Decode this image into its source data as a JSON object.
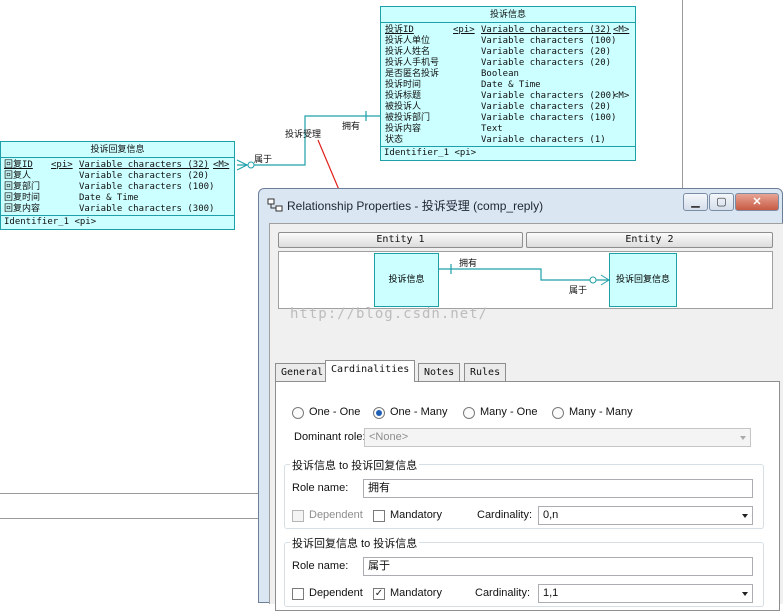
{
  "diagram": {
    "entity_main": {
      "title": "投诉信息",
      "rows": [
        {
          "name": "投诉ID",
          "key": "<pi>",
          "type": "Variable characters (32)",
          "flag": "<M>"
        },
        {
          "name": "投诉人单位",
          "key": "",
          "type": "Variable characters (100)",
          "flag": ""
        },
        {
          "name": "投诉人姓名",
          "key": "",
          "type": "Variable characters (20)",
          "flag": ""
        },
        {
          "name": "投诉人手机号",
          "key": "",
          "type": "Variable characters (20)",
          "flag": ""
        },
        {
          "name": "是否匿名投诉",
          "key": "",
          "type": "Boolean",
          "flag": ""
        },
        {
          "name": "投诉时间",
          "key": "",
          "type": "Date & Time",
          "flag": ""
        },
        {
          "name": "投诉标题",
          "key": "",
          "type": "Variable characters (200)",
          "flag": "<M>"
        },
        {
          "name": "被投诉人",
          "key": "",
          "type": "Variable characters (20)",
          "flag": ""
        },
        {
          "name": "被投诉部门",
          "key": "",
          "type": "Variable characters (100)",
          "flag": ""
        },
        {
          "name": "投诉内容",
          "key": "",
          "type": "Text",
          "flag": ""
        },
        {
          "name": "状态",
          "key": "",
          "type": "Variable characters (1)",
          "flag": ""
        }
      ],
      "identifier": "Identifier_1  <pi>"
    },
    "entity_reply": {
      "title": "投诉回复信息",
      "rows": [
        {
          "name": "回复ID",
          "key": "<pi>",
          "type": "Variable characters (32)",
          "flag": "<M>"
        },
        {
          "name": "回复人",
          "key": "",
          "type": "Variable characters (20)",
          "flag": ""
        },
        {
          "name": "回复部门",
          "key": "",
          "type": "Variable characters (100)",
          "flag": ""
        },
        {
          "name": "回复时间",
          "key": "",
          "type": "Date & Time",
          "flag": ""
        },
        {
          "name": "回复内容",
          "key": "",
          "type": "Variable characters (300)",
          "flag": ""
        }
      ],
      "identifier": "Identifier_1  <pi>"
    },
    "relationship_name": "投诉受理",
    "role_main": "拥有",
    "role_reply": "属于"
  },
  "dialog": {
    "title": "Relationship Properties - 投诉受理 (comp_reply)",
    "entity1_label": "Entity 1",
    "entity2_label": "Entity 2",
    "preview": {
      "left_entity": "投诉信息",
      "right_entity": "投诉回复信息",
      "role_top": "拥有",
      "role_bottom": "属于"
    },
    "watermark": "http://blog.csdn.net/",
    "tabs": [
      "General",
      "Cardinalities",
      "Notes",
      "Rules"
    ],
    "active_tab": "Cardinalities",
    "cardinality_options": [
      "One - One",
      "One - Many",
      "Many - One",
      "Many - Many"
    ],
    "selected_option": "One - Many",
    "dominant_role_label": "Dominant role:",
    "dominant_role_value": "<None>",
    "group1": {
      "title": "投诉信息 to 投诉回复信息",
      "role_label": "Role name:",
      "role_value": "拥有",
      "dependent_label": "Dependent",
      "dependent_checked": false,
      "mandatory_label": "Mandatory",
      "mandatory_checked": false,
      "cardinality_label": "Cardinality:",
      "cardinality_value": "0,n"
    },
    "group2": {
      "title": "投诉回复信息 to 投诉信息",
      "role_label": "Role name:",
      "role_value": "属于",
      "dependent_label": "Dependent",
      "dependent_checked": false,
      "mandatory_label": "Mandatory",
      "mandatory_checked": true,
      "cardinality_label": "Cardinality:",
      "cardinality_value": "1,1"
    }
  },
  "colors": {
    "entity_fill": "#ccffff",
    "entity_border": "#1fa0a8",
    "annotation_arrow": "#e0201b",
    "radio_selected": "#1f5fb6"
  }
}
